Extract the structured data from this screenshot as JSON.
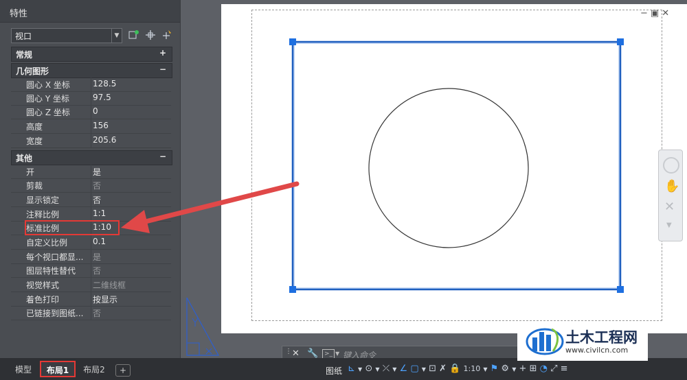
{
  "palette": {
    "title": "特性",
    "object_type": "视口",
    "sections": {
      "general": {
        "label": "常规",
        "toggle": "+"
      },
      "geometry": {
        "label": "几何图形",
        "toggle": "−"
      },
      "misc": {
        "label": "其他",
        "toggle": "−"
      }
    },
    "geometry_rows": [
      {
        "key": "圆心 X 坐标",
        "value": "128.5"
      },
      {
        "key": "圆心 Y 坐标",
        "value": "97.5"
      },
      {
        "key": "圆心 Z 坐标",
        "value": "0"
      },
      {
        "key": "高度",
        "value": "156"
      },
      {
        "key": "宽度",
        "value": "205.6"
      }
    ],
    "misc_rows": [
      {
        "key": "开",
        "value": "是"
      },
      {
        "key": "剪裁",
        "value": "否"
      },
      {
        "key": "显示锁定",
        "value": "否"
      },
      {
        "key": "注释比例",
        "value": "1:1"
      },
      {
        "key": "标准比例",
        "value": "1:10"
      },
      {
        "key": "自定义比例",
        "value": "0.1"
      },
      {
        "key": "每个视口都显...",
        "value": "是"
      },
      {
        "key": "图层特性替代",
        "value": "否"
      },
      {
        "key": "视觉样式",
        "value": "二维线框"
      },
      {
        "key": "着色打印",
        "value": "按显示"
      },
      {
        "key": "已链接到图纸...",
        "value": "否"
      }
    ]
  },
  "tabs": [
    {
      "label": "模型"
    },
    {
      "label": "布局1"
    },
    {
      "label": "布局2"
    },
    {
      "label": "+"
    }
  ],
  "command": {
    "placeholder": "键入命令",
    "close": "✕"
  },
  "statusbar": {
    "paper": "图纸",
    "scale": "1:10"
  },
  "watermark": {
    "name": "土木工程网",
    "url": "www.civilcn.com"
  },
  "colors": {
    "highlight_box": "#e53935",
    "arrow": "#e04848",
    "viewport": "#1f5fbf",
    "grip": "#1e6fe0"
  }
}
